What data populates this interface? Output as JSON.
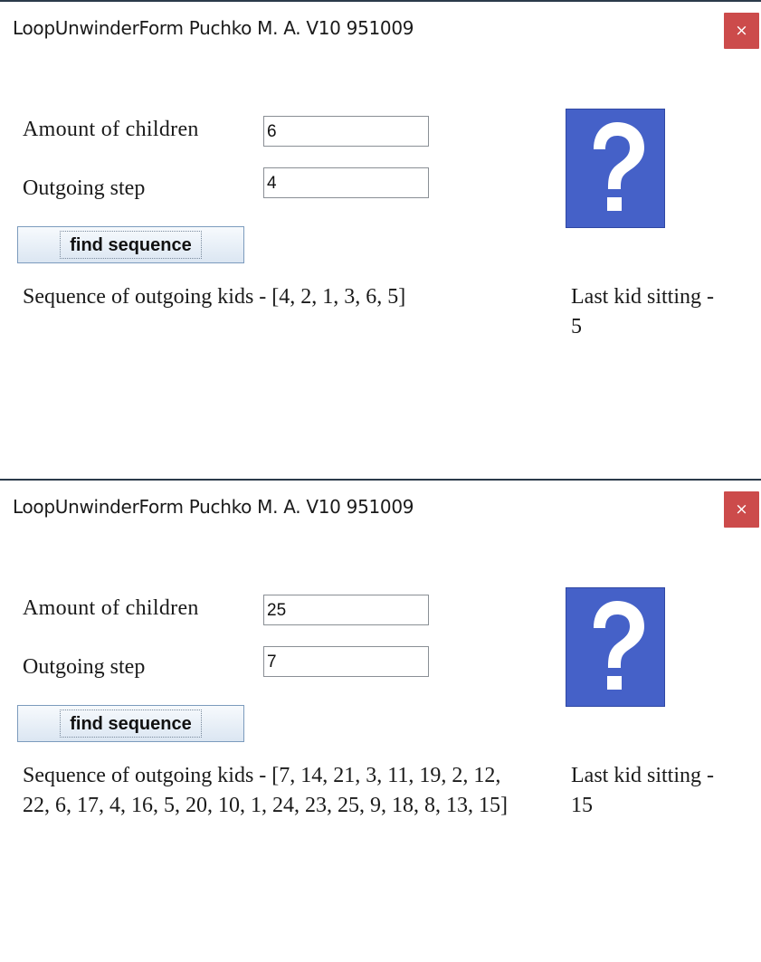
{
  "windows": [
    {
      "title": "LoopUnwinderForm Puchko M. A. V10 951009",
      "close_label": "×",
      "amount_label": "Amount of children",
      "amount_value": "6",
      "step_label": "Outgoing step",
      "step_value": "4",
      "button_label": "find sequence",
      "image_icon": "question-mark-icon",
      "sequence_text": "Sequence of outgoing kids - [4, 2, 1, 3, 6, 5]",
      "last_kid_text": "Last kid sitting - 5"
    },
    {
      "title": "LoopUnwinderForm Puchko M. A. V10 951009",
      "close_label": "×",
      "amount_label": "Amount of children",
      "amount_value": "25",
      "step_label": "Outgoing step",
      "step_value": "7",
      "button_label": "find sequence",
      "image_icon": "question-mark-icon",
      "sequence_text": "Sequence of outgoing kids - [7, 14, 21, 3, 11, 19, 2, 12, 22, 6, 17, 4, 16, 5, 20, 10, 1, 24, 23, 25, 9, 18, 8, 13, 15]",
      "last_kid_text": "Last kid sitting - 15"
    }
  ],
  "colors": {
    "close_button": "#cc4b4b",
    "image_background": "#4561c8",
    "button_border": "#7c9bbd"
  }
}
